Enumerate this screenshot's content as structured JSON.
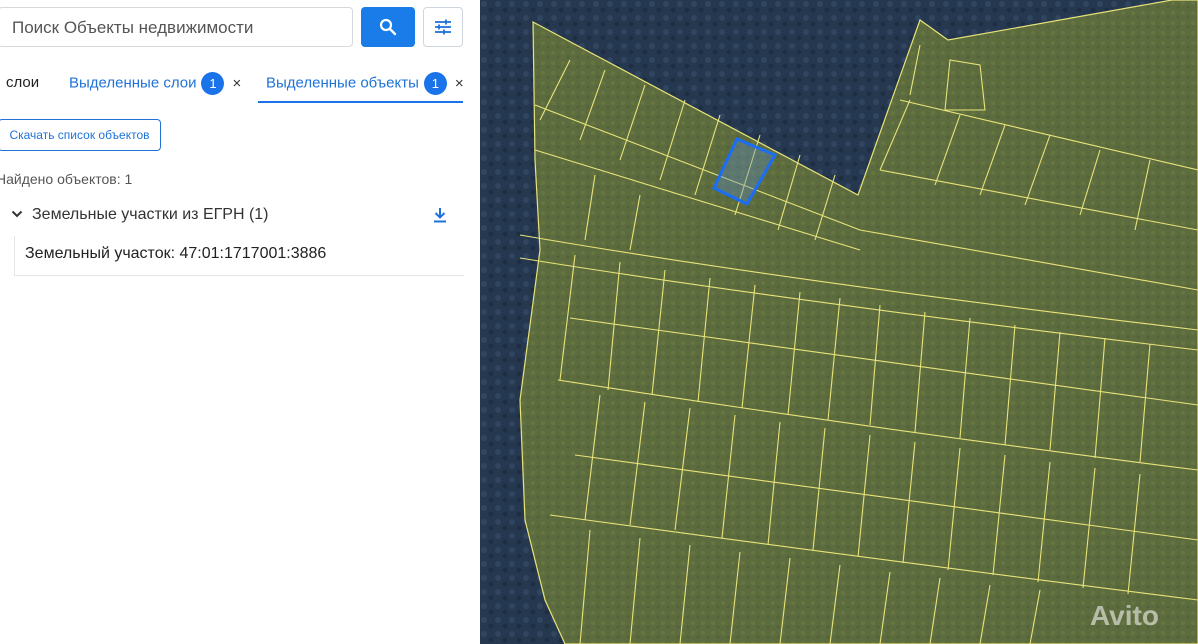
{
  "search": {
    "placeholder": "Поиск Объекты недвижимости"
  },
  "tabs": [
    {
      "label": "слои"
    },
    {
      "label": "Выделенные слои",
      "badge": "1"
    },
    {
      "label": "Выделенные объекты",
      "badge": "1"
    }
  ],
  "tab_close_glyph": "×",
  "download_list_label": "Скачать список объектов",
  "found_text": "Найдено объектов: 1",
  "group": {
    "title": "Земельные участки из ЕГРН (1)"
  },
  "item": {
    "label": "Земельный участок: 47:01:1717001:3886"
  },
  "watermark": "Avito",
  "colors": {
    "accent": "#1a73e8",
    "parcel_border": "#e8e37a",
    "selected_parcel": "#1a6ef5",
    "forest": "#23364f",
    "land": "#5b6a3e"
  },
  "icons": {
    "search": "search-icon",
    "filter": "sliders-icon",
    "chevron": "chevron-down-icon",
    "download": "download-icon",
    "close": "close-icon"
  }
}
